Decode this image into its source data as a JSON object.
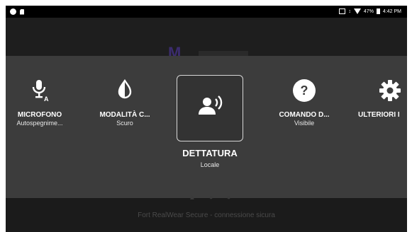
{
  "statusbar": {
    "battery": "47%",
    "time": "4:42 PM"
  },
  "background": {
    "footer_text": "Fort RealWear Secure - connessione sicura"
  },
  "menu": {
    "items": [
      {
        "label": "MICROFONO",
        "sub": "Autospegnime...",
        "icon": "microphone-auto-icon"
      },
      {
        "label": "MODALITÀ C...",
        "sub": "Scuro",
        "icon": "contrast-icon"
      },
      {
        "label": "DETTATURA",
        "sub": "Locale",
        "icon": "dictation-icon",
        "selected": true
      },
      {
        "label": "COMANDO D...",
        "sub": "Visibile",
        "icon": "help-icon"
      },
      {
        "label": "ULTERIORI I",
        "sub": "",
        "icon": "gear-icon"
      }
    ]
  },
  "colors": {
    "panel": "#3c3c3c",
    "screen": "#1b1b1b",
    "text": "#ffffff"
  }
}
